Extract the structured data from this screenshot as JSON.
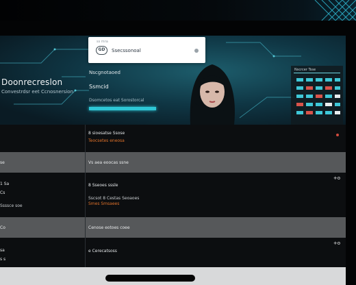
{
  "hero": {
    "brand_title": "Doonrecreslon",
    "brand_subtitle": "Convestrdsr eet Ccnosnersion",
    "search_top_label": "ss mra",
    "search_logo": "GD",
    "search_app_name": "Ssecssonoal",
    "label": "Nscgnotaoed",
    "heading": "Ssmcid",
    "line1": "Dsomcetos eat Sorostorcal",
    "dashboard_title": "Nscrcer Tsse"
  },
  "rows": [
    {
      "left": "",
      "right": "8 sioesatse Ssose",
      "right_sub": "Teocsetes eneosa",
      "type": "dark",
      "has_dot": true
    },
    {
      "left": "se",
      "right": "Vs aea eoocas ssne",
      "right_sub": "",
      "type": "grey"
    },
    {
      "left": "1 Sa",
      "left2": "Cs",
      "left3": "Ssssce soe",
      "right": "8 Sseoes sssle",
      "right_sub": "Sscsot 8 Cestas Seoaoes",
      "right_sub2": "Smes Smsaees",
      "type": "dark",
      "action": "+o"
    },
    {
      "left": "Co",
      "right": "Cenose eotoes coee",
      "right_sub": "",
      "type": "grey"
    },
    {
      "left": "sa",
      "left2": "s s",
      "right": "e Cerecatsoss",
      "type": "dark",
      "action": "+o"
    }
  ],
  "colors": {
    "accent": "#2ec7d6",
    "orange": "#e0722a",
    "alert": "#d24b3e"
  }
}
